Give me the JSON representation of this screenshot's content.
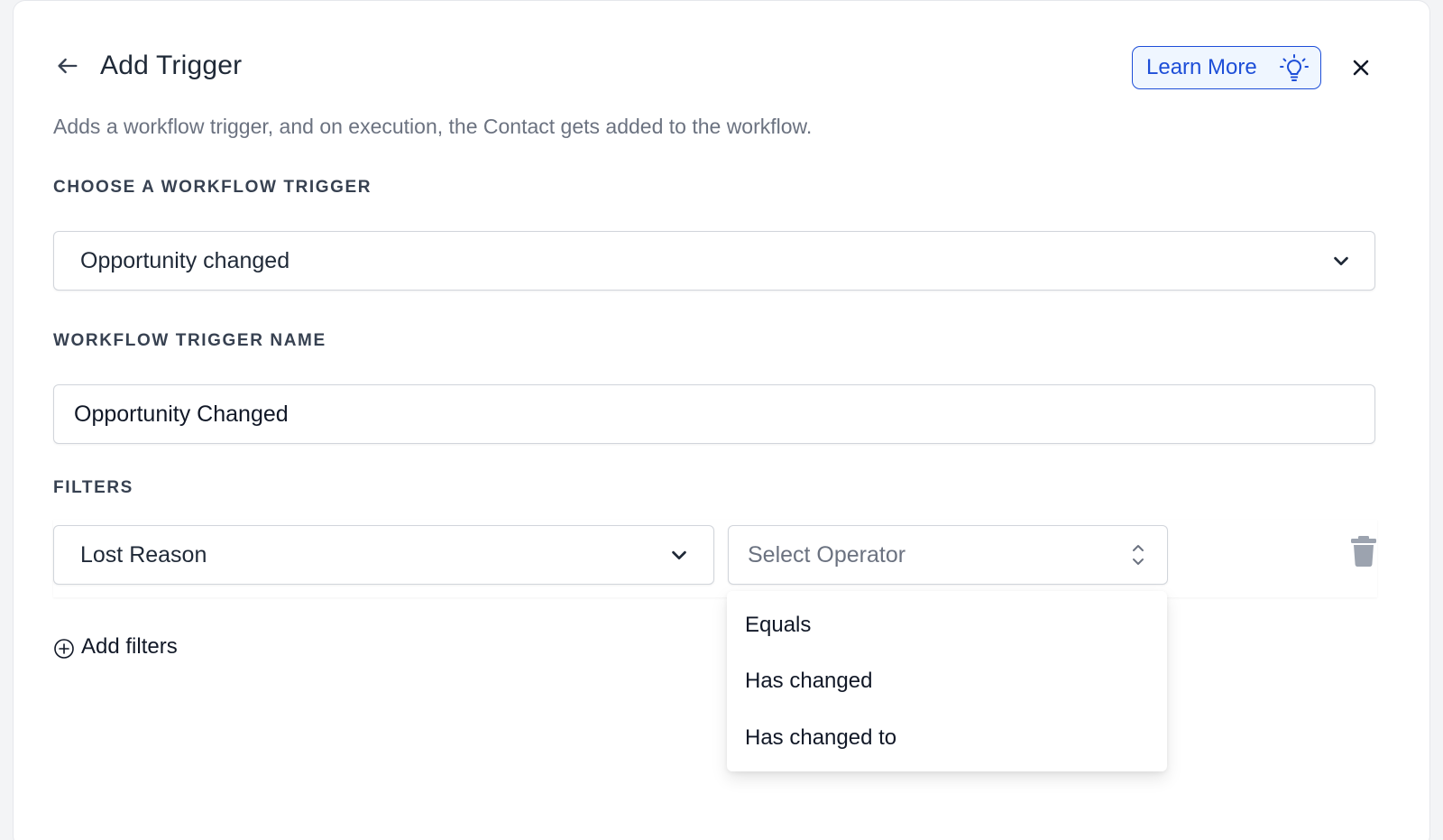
{
  "header": {
    "title": "Add Trigger",
    "learn_more_label": "Learn More"
  },
  "subtitle": "Adds a workflow trigger, and on execution, the Contact gets added to the workflow.",
  "trigger_section": {
    "label": "CHOOSE A WORKFLOW TRIGGER",
    "selected": "Opportunity changed"
  },
  "name_section": {
    "label": "WORKFLOW TRIGGER NAME",
    "value": "Opportunity Changed"
  },
  "filters_section": {
    "label": "FILTERS",
    "field_value": "Lost Reason",
    "operator_placeholder": "Select Operator",
    "operator_options": [
      "Equals",
      "Has changed",
      "Has changed to"
    ],
    "add_filters_label": "Add filters"
  },
  "colors": {
    "accent": "#1d4ed8",
    "accent_bg": "#eff6ff",
    "border": "#d1d5db",
    "muted_text": "#6b7280"
  },
  "icons": {
    "back": "arrow-left-icon",
    "learn_more": "lightbulb-icon",
    "close": "close-icon",
    "select": "chevron-down-icon",
    "operator": "chevron-up-down-icon",
    "delete": "trash-icon",
    "add": "plus-circle-icon"
  }
}
